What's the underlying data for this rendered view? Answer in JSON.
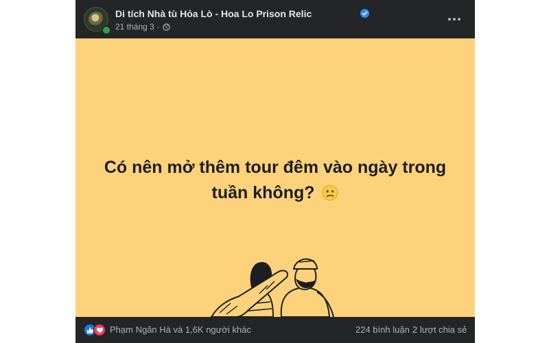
{
  "post": {
    "page_name": "Di tích Nhà tù Hỏa Lò - Hoa Lo Prison Relic",
    "date": "21 tháng 3",
    "separator": "·",
    "privacy_icon": "globe-icon",
    "verified_icon": "verified-badge-icon",
    "more_icon": "more-options-icon",
    "image_text": "Có nên mở thêm tour đêm vào ngày trong tuần không?",
    "image_emoji": "confused-face-emoji",
    "image_background": "#fed27a"
  },
  "footer": {
    "reaction_icons": [
      "like-icon",
      "love-icon"
    ],
    "reactions_text": "Phạm Ngân Hà và 1,6K người khác",
    "comments": "224 bình luận",
    "shares": "2 lượt chia sẻ"
  },
  "colors": {
    "card_background": "#242526",
    "text_primary": "#e4e6eb",
    "text_secondary": "#b0b3b8",
    "verified_blue": "#2d88ff",
    "like_blue": "#1877f2",
    "love_red": "#f33e58"
  }
}
